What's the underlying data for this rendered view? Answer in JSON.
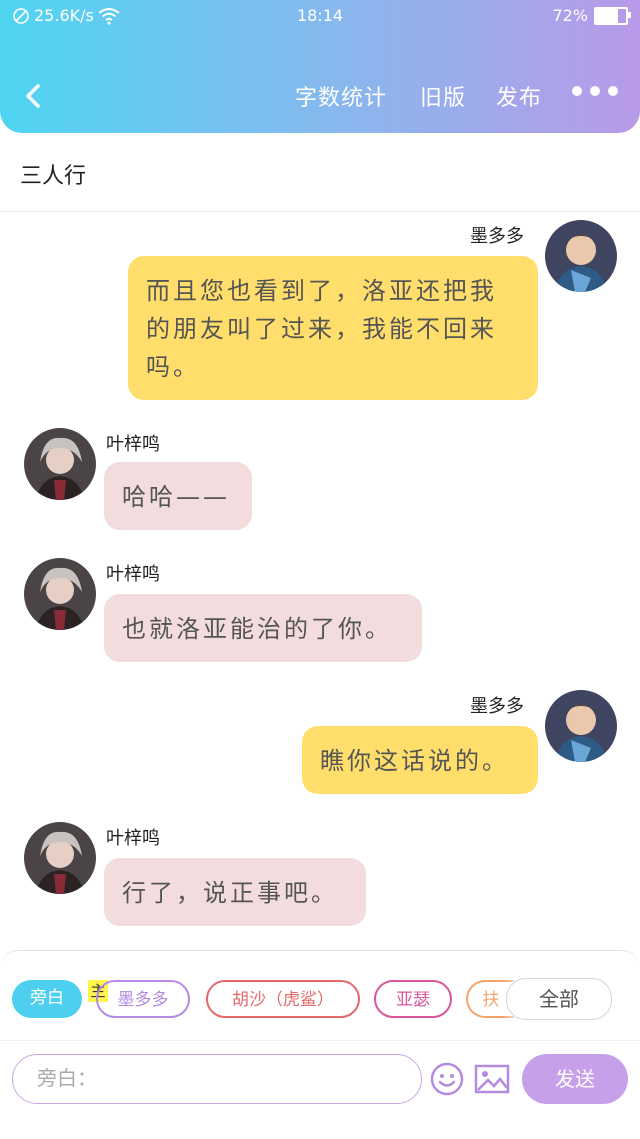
{
  "status_bar": {
    "speed": "25.6K/s",
    "time": "18:14",
    "battery": "72%",
    "battery_level": 0.72
  },
  "header": {
    "actions": [
      "字数统计",
      "旧版",
      "发布"
    ]
  },
  "page_title": "三人行",
  "messages": [
    {
      "side": "right",
      "name": "墨多多",
      "text": "而且您也看到了，洛亚还把我的朋友叫了过来，我能不回来吗。",
      "color": "yellow"
    },
    {
      "side": "left",
      "name": "叶梓鸣",
      "text": "哈哈——",
      "color": "pink"
    },
    {
      "side": "left",
      "name": "叶梓鸣",
      "text": "也就洛亚能治的了你。",
      "color": "pink"
    },
    {
      "side": "right",
      "name": "墨多多",
      "text": "瞧你这话说的。",
      "color": "yellow"
    },
    {
      "side": "left",
      "name": "叶梓鸣",
      "text": "行了，说正事吧。",
      "color": "pink"
    }
  ],
  "roles": {
    "tag": "主",
    "chips": [
      "旁白",
      "墨多多",
      "胡沙（虎鲨）",
      "亚瑟",
      "扶",
      "全部"
    ]
  },
  "composer": {
    "placeholder": "旁白：",
    "send": "发送"
  },
  "colors": {
    "yellow_bubble": "#ffde6b",
    "pink_bubble": "#f2dcde",
    "accent": "#c7a0ea"
  }
}
